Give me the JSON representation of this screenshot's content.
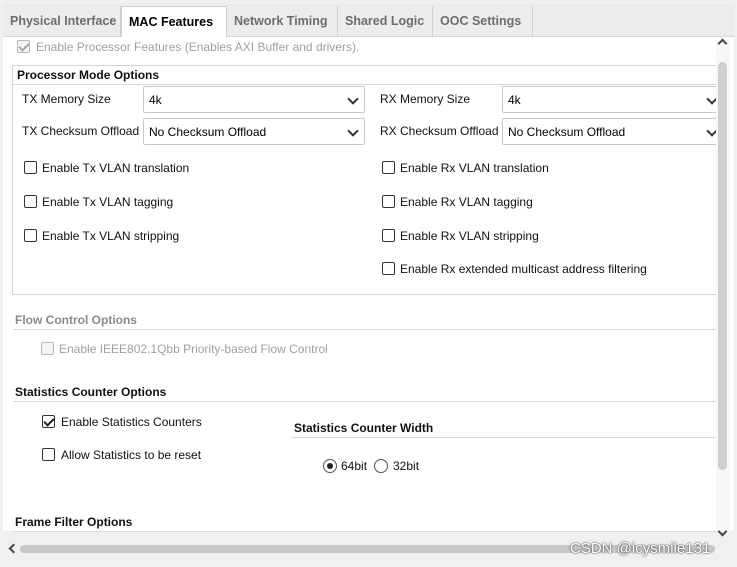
{
  "tabs": [
    {
      "label": "Physical Interface",
      "active": false
    },
    {
      "label": "MAC Features",
      "active": true
    },
    {
      "label": "Network Timing",
      "active": false
    },
    {
      "label": "Shared Logic",
      "active": false
    },
    {
      "label": "OOC Settings",
      "active": false
    }
  ],
  "enable_processor": {
    "label": "Enable Processor Features (Enables AXI Buffer and drivers).",
    "checked": true,
    "disabled": true
  },
  "processor_mode": {
    "title": "Processor Mode Options",
    "tx_memory_size": {
      "label": "TX Memory Size",
      "value": "4k"
    },
    "rx_memory_size": {
      "label": "RX Memory Size",
      "value": "4k"
    },
    "tx_checksum": {
      "label": "TX Checksum Offload",
      "value": "No Checksum Offload"
    },
    "rx_checksum": {
      "label": "RX Checksum Offload",
      "value": "No Checksum Offload"
    },
    "tx_vlan_translation": {
      "label": "Enable Tx VLAN translation",
      "checked": false
    },
    "tx_vlan_tagging": {
      "label": "Enable Tx VLAN tagging",
      "checked": false
    },
    "tx_vlan_stripping": {
      "label": "Enable Tx VLAN stripping",
      "checked": false
    },
    "rx_vlan_translation": {
      "label": "Enable Rx VLAN translation",
      "checked": false
    },
    "rx_vlan_tagging": {
      "label": "Enable Rx VLAN tagging",
      "checked": false
    },
    "rx_vlan_stripping": {
      "label": "Enable Rx VLAN stripping",
      "checked": false
    },
    "rx_multicast_filter": {
      "label": "Enable Rx extended multicast address filtering",
      "checked": false
    }
  },
  "flow_control": {
    "title": "Flow Control Options",
    "pfc": {
      "label": "Enable IEEE802.1Qbb Priority-based Flow Control",
      "checked": false,
      "disabled": true
    }
  },
  "statistics": {
    "title": "Statistics Counter Options",
    "enable_counters": {
      "label": "Enable Statistics Counters",
      "checked": true
    },
    "allow_reset": {
      "label": "Allow Statistics to be reset",
      "checked": false
    },
    "width_title": "Statistics Counter Width",
    "width_options": [
      {
        "label": "64bit",
        "selected": true
      },
      {
        "label": "32bit",
        "selected": false
      }
    ]
  },
  "frame_filter": {
    "title": "Frame Filter Options"
  },
  "watermark": "CSDN @icysmile131"
}
